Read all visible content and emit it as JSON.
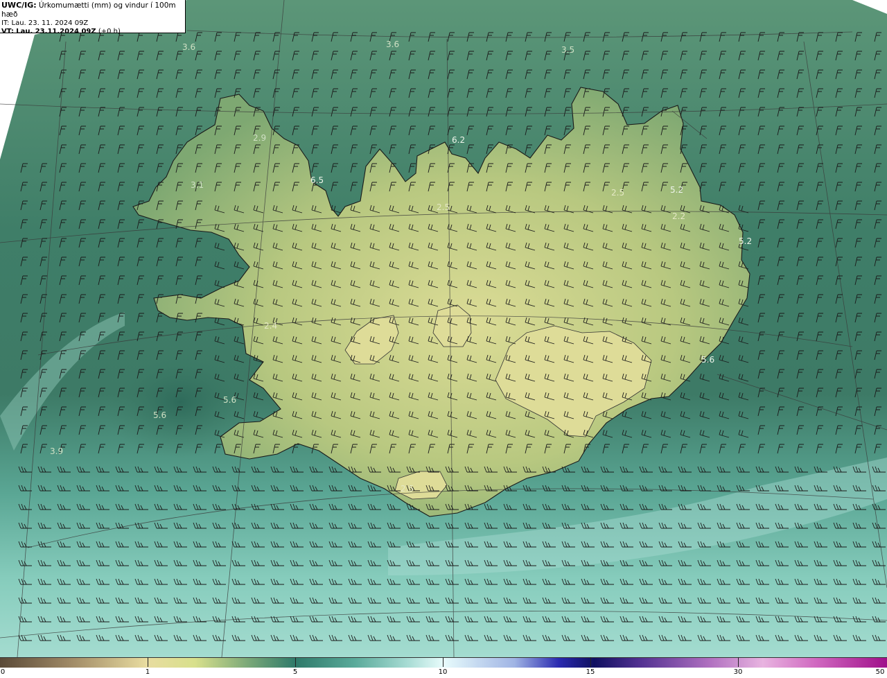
{
  "header": {
    "title_code": "UWC/IG:",
    "title_desc": "Úrkomumætti (mm) og vindur í 100m hæð",
    "it_label": "IT:",
    "it_value": "Lau. 23. 11. 2024 09Z",
    "vt_label": "VT:",
    "vt_value": "Lau. 23.11.2024 09Z",
    "vt_offset": "(+0 h)"
  },
  "map_labels": [
    {
      "text": "3.6",
      "color": "#cfe0c4"
    },
    {
      "text": "3.6",
      "color": "#cfe0c4"
    },
    {
      "text": "3.5",
      "color": "#cfe0c4"
    },
    {
      "text": "2.9",
      "color": "#cfe0c4"
    },
    {
      "text": "3.1",
      "color": "#cfe0c4"
    },
    {
      "text": "6.5",
      "color": "#eef4ea"
    },
    {
      "text": "6.2",
      "color": "#eef4ea"
    },
    {
      "text": "2.5",
      "color": "#e4e8c4"
    },
    {
      "text": "2.5",
      "color": "#e4e8c4"
    },
    {
      "text": "5.2",
      "color": "#eef4ea"
    },
    {
      "text": "2.2",
      "color": "#e4e8c4"
    },
    {
      "text": "5.2",
      "color": "#eef4ea"
    },
    {
      "text": "2.4",
      "color": "#e4e8c4"
    },
    {
      "text": "5.6",
      "color": "#eef4ea"
    },
    {
      "text": "5.6",
      "color": "#cfe0c4"
    },
    {
      "text": "5.6",
      "color": "#cfe0c4"
    },
    {
      "text": "3.9",
      "color": "#cfe0c4"
    },
    {
      "text": "2.5",
      "color": "#e4e8c4"
    }
  ],
  "colorscale": {
    "labels": [
      "0",
      "1",
      "5",
      "10",
      "15",
      "30",
      "50"
    ]
  },
  "colors": {
    "ocean_dark": "#2f6e5e",
    "ocean_mid": "#4c8a72",
    "land_light": "#d4d890",
    "ocean_south": "#7cc4b4"
  }
}
